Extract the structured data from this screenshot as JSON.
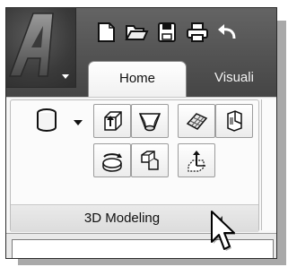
{
  "app": {
    "menu_icon": "autocad-logo-icon",
    "quick_access": [
      "new-document-icon",
      "open-folder-icon",
      "save-icon",
      "print-icon",
      "undo-icon"
    ]
  },
  "tabs": {
    "home": "Home",
    "visualize": "Visuali"
  },
  "panel": {
    "title": "3D Modeling",
    "tools": [
      "cylinder-icon",
      "extrude-icon",
      "loft-icon",
      "planar-surface-icon",
      "presspull-icon",
      "revolve-icon",
      "sweep-icon",
      "gizmo-move-icon"
    ]
  },
  "colors": {
    "titlebar": "#545454",
    "ribbon": "#f7f7f7",
    "panel_footer": "#dcdcdc"
  }
}
